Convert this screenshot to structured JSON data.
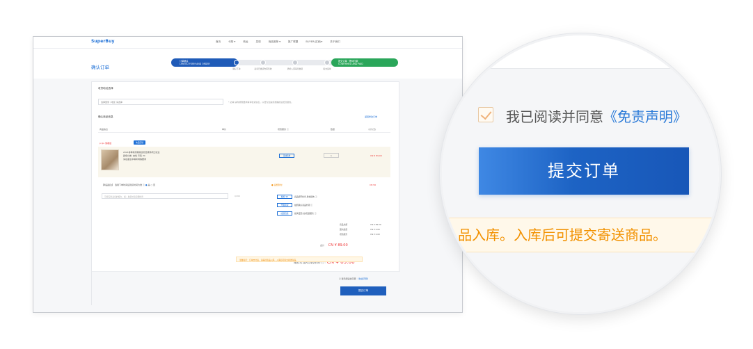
{
  "page": {
    "logo": "SuperBuy",
    "nav": [
      "首页",
      "代购 ▾",
      "转运",
      "发现",
      "商品推荐 ▾",
      "推广联盟",
      "BUYER(买家)▾",
      "关于我们"
    ],
    "title": "确认订单",
    "steps": {
      "active": "订单确认",
      "active_sub": "LIMITED FORM AND ORDER",
      "done": "提交订单 · 等待付款",
      "done_sub": "CONFIRMED AND PAID",
      "labels": [
        "确认下单",
        "卖家已发货仓库签收",
        "质检入库等待发货",
        "提交运单"
      ]
    },
    "delivery_section": "收货地址选择",
    "delivery_select": "选择国家 / 地区 请选择",
    "delivery_hint": "* 必填  请你按照要求填写收货信息，以便为您提供准确的运费及服务。",
    "hint_required": "* 必填",
    "product_section": "确认商品信息",
    "product_link": "返回修改订单",
    "table_headers": [
      "商品信息",
      "单价",
      "增值服务 ⓘ",
      "数量",
      "小计(元)"
    ],
    "store_name": "pi jiu 旗舰店",
    "store_tag": "淘宝店铺",
    "item": {
      "desc": "2021春季新款韩版宽松百搭休闲卫衣女",
      "option": "颜色分类: 杏色 尺码: M",
      "note": "请在备注中填写特殊要求",
      "tag": "基础质检",
      "qty": "1",
      "price": "CN ¥ 89.00"
    },
    "package_text": "【商品备注】 选用下单时间后到货时间为准 ⓘ",
    "package_yes": "是",
    "package_no": "否",
    "orange_note": "● 运费到付",
    "red_note": "CN ¥0",
    "remark_placeholder": "可填写给卖家的留言，如：发货时请仔细检查",
    "remark_count": "0/200",
    "services": [
      {
        "box": "精检 ¥5",
        "text": "商品细节检查 质检报告 ⓘ"
      },
      {
        "box": "开箱验货",
        "text": "拍照确认商品外观 ⓘ"
      },
      {
        "box": "加固包装",
        "text": "提供更安全的包装服务 ⓘ"
      }
    ],
    "summary": [
      {
        "label": "商品总额",
        "value": "CN ¥ 89.00"
      },
      {
        "label": "国内运费",
        "value": "CN ¥ 0.00"
      },
      {
        "label": "增值服务",
        "value": "CN ¥ 0.00"
      }
    ],
    "subtotal_label": "合计",
    "subtotal_value": "CN ¥ 89.00",
    "grand_total_label": "商品1件 国内订单总价(价) ⓘ :",
    "grand_total_value": "CN ¥ 89.00",
    "agree_text": "我已阅读并同意",
    "agree_link": "《免责声明》",
    "submit": "提交订单",
    "warning": "温馨提示：订单支付后，请等待商品入库。入库后可提交寄送商品。"
  },
  "zoom": {
    "agree_text": "我已阅读并同意",
    "agree_link": "《免责声明》",
    "submit": "提交订单",
    "warning": "品入库。入库后可提交寄送商品。"
  },
  "colors": {
    "accent": "#1d63c4",
    "success": "#2aa65a",
    "warning": "#f29100",
    "price": "#e33333"
  }
}
